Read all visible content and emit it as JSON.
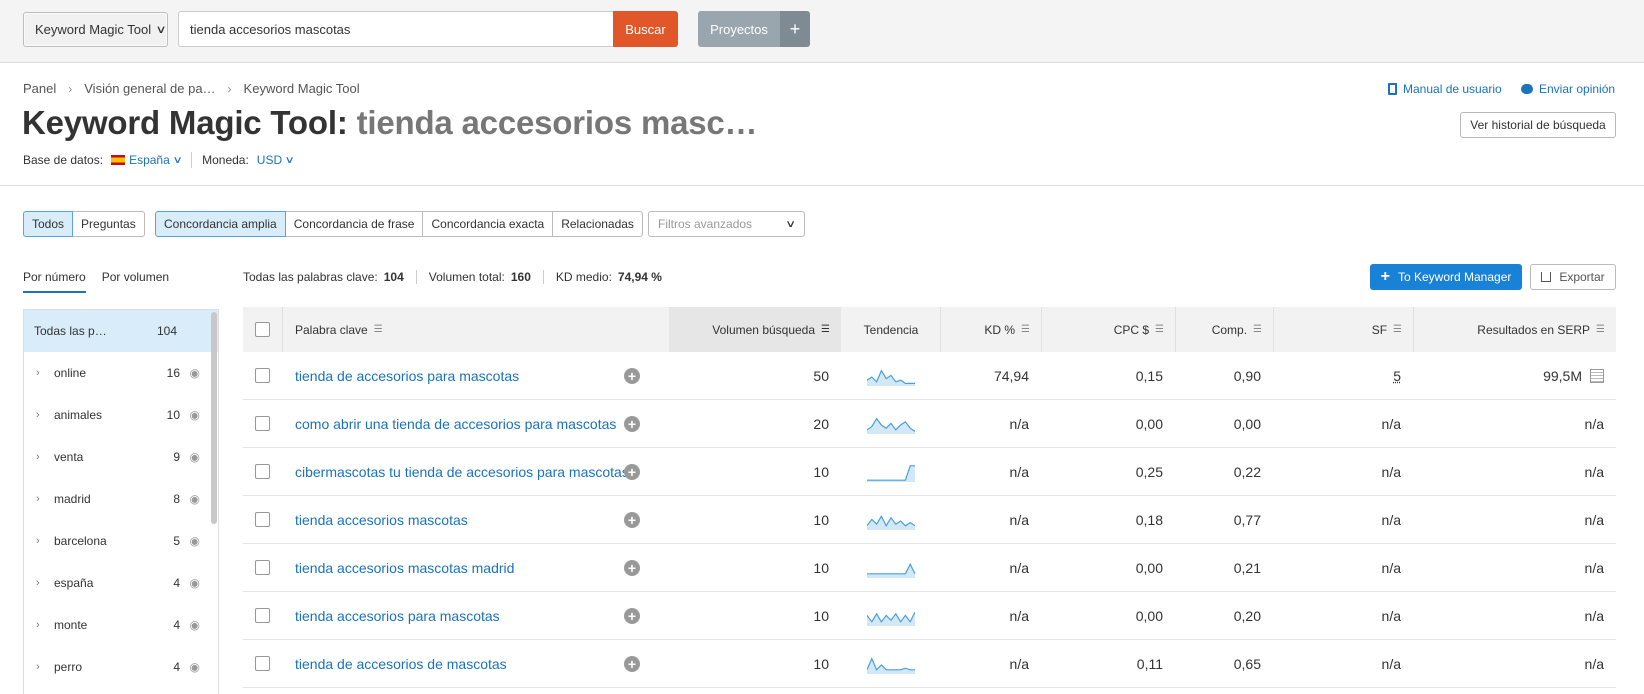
{
  "topbar": {
    "tool_select": "Keyword Magic Tool",
    "search_value": "tienda accesorios mascotas",
    "search_button": "Buscar",
    "projects_button": "Proyectos",
    "projects_plus": "+"
  },
  "breadcrumb": [
    "Panel",
    "Visión general de pa…",
    "Keyword Magic Tool"
  ],
  "title": {
    "prefix": "Keyword Magic Tool: ",
    "query": "tienda accesorios masc…"
  },
  "database": {
    "label": "Base de datos:",
    "value": "España",
    "currency_label": "Moneda:",
    "currency_value": "USD"
  },
  "header_links": {
    "manual": "Manual de usuario",
    "feedback": "Enviar opinión",
    "history": "Ver historial de búsqueda"
  },
  "filters": {
    "group1": [
      "Todos",
      "Preguntas"
    ],
    "group2": [
      "Concordancia amplia",
      "Concordancia de frase",
      "Concordancia exacta",
      "Relacionadas"
    ],
    "advanced_placeholder": "Filtros avanzados"
  },
  "left_tabs": [
    "Por número",
    "Por volumen"
  ],
  "stats": {
    "all_label": "Todas las palabras clave:",
    "all_value": "104",
    "volume_label": "Volumen total:",
    "volume_value": "160",
    "kd_label": "KD medio:",
    "kd_value": "74,94 %"
  },
  "actions": {
    "keyword_manager": "To Keyword Manager",
    "export": "Exportar"
  },
  "sidebar": {
    "all": {
      "label": "Todas las p…",
      "count": "104"
    },
    "items": [
      {
        "label": "online",
        "count": "16"
      },
      {
        "label": "animales",
        "count": "10"
      },
      {
        "label": "venta",
        "count": "9"
      },
      {
        "label": "madrid",
        "count": "8"
      },
      {
        "label": "barcelona",
        "count": "5"
      },
      {
        "label": "españa",
        "count": "4"
      },
      {
        "label": "monte",
        "count": "4"
      },
      {
        "label": "perro",
        "count": "4"
      }
    ]
  },
  "table": {
    "headers": {
      "keyword": "Palabra clave",
      "volume": "Volumen búsqueda",
      "trend": "Tendencia",
      "kd": "KD %",
      "cpc": "CPC $",
      "comp": "Comp.",
      "sf": "SF",
      "serp": "Resultados en SERP"
    },
    "rows": [
      {
        "keyword": "tienda de accesorios para mascotas",
        "volume": "50",
        "kd": "74,94",
        "cpc": "0,15",
        "comp": "0,90",
        "sf": "5",
        "serp": "99,5M",
        "trend": [
          0.3,
          0.5,
          0.2,
          0.9,
          0.4,
          0.6,
          0.2,
          0.3,
          0.1,
          0.1,
          0.1
        ]
      },
      {
        "keyword": "como abrir una tienda de accesorios para mascotas",
        "volume": "20",
        "kd": "n/a",
        "cpc": "0,00",
        "comp": "0,00",
        "sf": "n/a",
        "serp": "n/a",
        "trend": [
          0.2,
          0.4,
          0.9,
          0.5,
          0.3,
          0.6,
          0.2,
          0.5,
          0.7,
          0.3,
          0.1
        ]
      },
      {
        "keyword": "cibermascotas tu tienda de accesorios para mascotas",
        "volume": "10",
        "kd": "n/a",
        "cpc": "0,25",
        "comp": "0,22",
        "sf": "n/a",
        "serp": "n/a",
        "trend": [
          0.05,
          0.05,
          0.05,
          0.05,
          0.05,
          0.05,
          0.05,
          0.05,
          0.05,
          0.95,
          0.95
        ]
      },
      {
        "keyword": "tienda accesorios mascotas",
        "volume": "10",
        "kd": "n/a",
        "cpc": "0,18",
        "comp": "0,77",
        "sf": "n/a",
        "serp": "n/a",
        "trend": [
          0.2,
          0.6,
          0.3,
          0.8,
          0.2,
          0.7,
          0.3,
          0.5,
          0.2,
          0.4,
          0.2
        ]
      },
      {
        "keyword": "tienda accesorios mascotas madrid",
        "volume": "10",
        "kd": "n/a",
        "cpc": "0,00",
        "comp": "0,21",
        "sf": "n/a",
        "serp": "n/a",
        "trend": [
          0.2,
          0.2,
          0.2,
          0.2,
          0.2,
          0.2,
          0.2,
          0.2,
          0.2,
          0.8,
          0.2
        ]
      },
      {
        "keyword": "tienda accesorios para mascotas",
        "volume": "10",
        "kd": "n/a",
        "cpc": "0,00",
        "comp": "0,20",
        "sf": "n/a",
        "serp": "n/a",
        "trend": [
          0.6,
          0.2,
          0.7,
          0.2,
          0.6,
          0.3,
          0.7,
          0.2,
          0.6,
          0.2,
          0.8
        ]
      },
      {
        "keyword": "tienda de accesorios de mascotas",
        "volume": "10",
        "kd": "n/a",
        "cpc": "0,11",
        "comp": "0,65",
        "sf": "n/a",
        "serp": "n/a",
        "trend": [
          0.2,
          0.9,
          0.2,
          0.5,
          0.2,
          0.2,
          0.2,
          0.2,
          0.3,
          0.2,
          0.2
        ]
      }
    ]
  },
  "colors": {
    "accent": "#1a73bb",
    "search_button": "#e1572a",
    "active_filter": "#d9ecfa"
  }
}
